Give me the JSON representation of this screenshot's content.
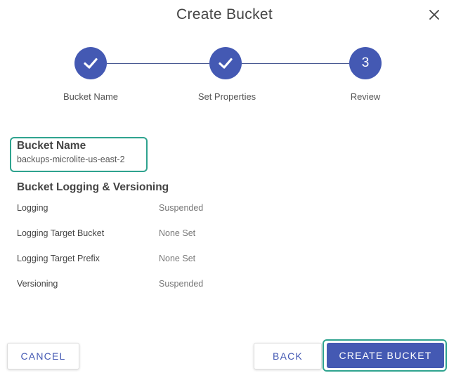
{
  "dialog": {
    "title": "Create Bucket"
  },
  "stepper": {
    "steps": [
      {
        "label": "Bucket Name",
        "state": "complete",
        "icon": "check-icon"
      },
      {
        "label": "Set Properties",
        "state": "complete",
        "icon": "check-icon"
      },
      {
        "label": "Review",
        "state": "active",
        "number": "3"
      }
    ]
  },
  "review": {
    "bucket_name_heading": "Bucket Name",
    "bucket_name_value": "backups-microlite-us-east-2",
    "logging_heading": "Bucket Logging & Versioning",
    "properties": [
      {
        "label": "Logging",
        "value": "Suspended"
      },
      {
        "label": "Logging Target Bucket",
        "value": "None Set"
      },
      {
        "label": "Logging Target Prefix",
        "value": "None Set"
      },
      {
        "label": "Versioning",
        "value": "Suspended"
      }
    ]
  },
  "actions": {
    "cancel_label": "CANCEL",
    "back_label": "BACK",
    "create_label": "CREATE BUCKET"
  },
  "colors": {
    "primary": "#4459b3",
    "highlight": "#2fa38f"
  }
}
